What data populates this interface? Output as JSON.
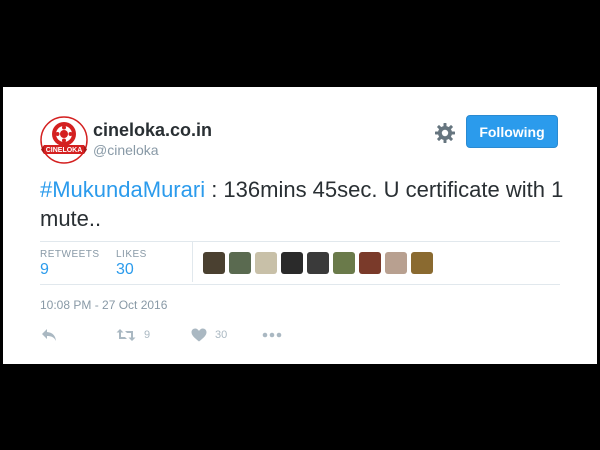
{
  "colors": {
    "accent": "#2b9bec",
    "text": "#292f33",
    "muted": "#8899a6",
    "action_icon": "#aab8c2",
    "background": "#000000",
    "card": "#ffffff"
  },
  "profile": {
    "avatar_icon": "cineloka-logo-icon",
    "logo_text": "CINELOKA",
    "display_name": "cineloka.co.in",
    "handle": "@cineloka"
  },
  "header": {
    "settings_icon": "gear-icon",
    "follow_button_label": "Following"
  },
  "tweet": {
    "hashtag": "#MukundaMurari",
    "text_after_hashtag": " : 136mins 45sec. U certificate with 1 mute.."
  },
  "stats": {
    "retweets_label": "RETWEETS",
    "retweets_value": "9",
    "likes_label": "LIKES",
    "likes_value": "30"
  },
  "likers": [
    {
      "name": "liker-avatar-1",
      "color": "#4a4030"
    },
    {
      "name": "liker-avatar-2",
      "color": "#5a6a50"
    },
    {
      "name": "liker-avatar-3",
      "color": "#c8c0a8"
    },
    {
      "name": "liker-avatar-4",
      "color": "#2a2a2a"
    },
    {
      "name": "liker-avatar-5",
      "color": "#3a3a3a"
    },
    {
      "name": "liker-avatar-6",
      "color": "#6a7a4a"
    },
    {
      "name": "liker-avatar-7",
      "color": "#7a3a2a"
    },
    {
      "name": "liker-avatar-8",
      "color": "#b8a090"
    },
    {
      "name": "liker-avatar-9",
      "color": "#8a6a30"
    }
  ],
  "meta": {
    "timestamp": "10:08 PM - 27 Oct 2016"
  },
  "actions": {
    "reply_icon": "reply-icon",
    "retweet_icon": "retweet-icon",
    "retweet_count": "9",
    "like_icon": "heart-icon",
    "like_count": "30",
    "more_icon": "more-icon"
  }
}
